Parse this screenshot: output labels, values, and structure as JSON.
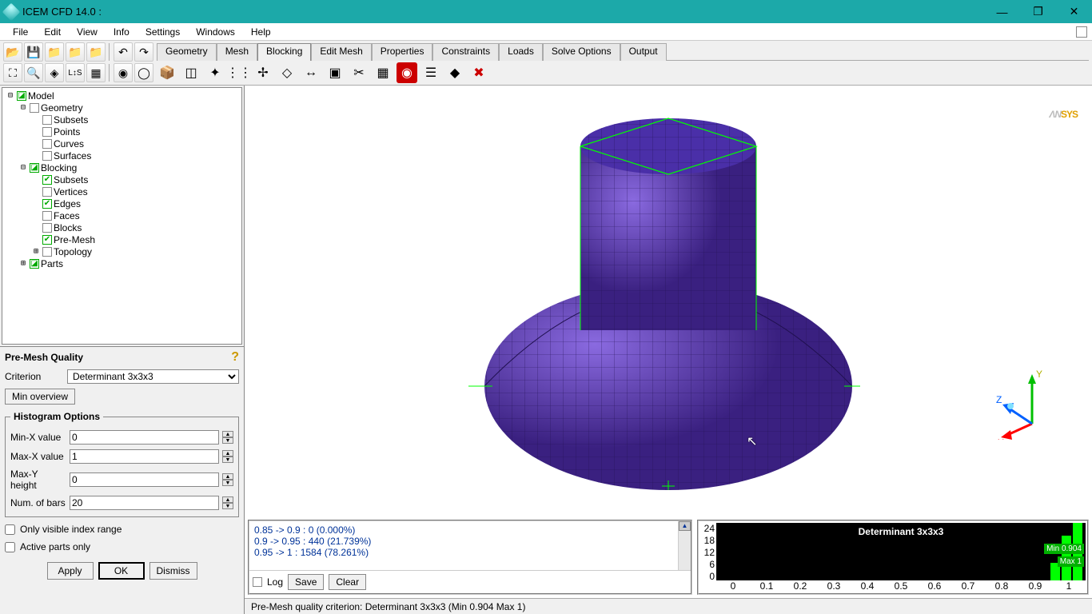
{
  "title": "ICEM CFD 14.0 :",
  "menu": [
    "File",
    "Edit",
    "View",
    "Info",
    "Settings",
    "Windows",
    "Help"
  ],
  "tabs": [
    "Geometry",
    "Mesh",
    "Blocking",
    "Edit Mesh",
    "Properties",
    "Constraints",
    "Loads",
    "Solve Options",
    "Output"
  ],
  "active_tab": 2,
  "tree": [
    {
      "depth": 0,
      "twisty": "⊟",
      "chk": "mixed",
      "label": "Model"
    },
    {
      "depth": 1,
      "twisty": "⊟",
      "chk": "",
      "label": "Geometry"
    },
    {
      "depth": 2,
      "twisty": "",
      "chk": "",
      "label": "Subsets"
    },
    {
      "depth": 2,
      "twisty": "",
      "chk": "",
      "label": "Points"
    },
    {
      "depth": 2,
      "twisty": "",
      "chk": "",
      "label": "Curves"
    },
    {
      "depth": 2,
      "twisty": "",
      "chk": "",
      "label": "Surfaces"
    },
    {
      "depth": 1,
      "twisty": "⊟",
      "chk": "mixed",
      "label": "Blocking"
    },
    {
      "depth": 2,
      "twisty": "",
      "chk": "on",
      "label": "Subsets"
    },
    {
      "depth": 2,
      "twisty": "",
      "chk": "",
      "label": "Vertices"
    },
    {
      "depth": 2,
      "twisty": "",
      "chk": "on",
      "label": "Edges"
    },
    {
      "depth": 2,
      "twisty": "",
      "chk": "",
      "label": "Faces"
    },
    {
      "depth": 2,
      "twisty": "",
      "chk": "",
      "label": "Blocks"
    },
    {
      "depth": 2,
      "twisty": "",
      "chk": "on",
      "label": "Pre-Mesh"
    },
    {
      "depth": 2,
      "twisty": "⊞",
      "chk": "",
      "label": "Topology"
    },
    {
      "depth": 1,
      "twisty": "⊞",
      "chk": "mixed",
      "label": "Parts"
    }
  ],
  "panel": {
    "title": "Pre-Mesh Quality",
    "criterion_label": "Criterion",
    "criterion_value": "Determinant 3x3x3",
    "min_overview": "Min overview",
    "hist_legend": "Histogram Options",
    "minx_label": "Min-X value",
    "minx_value": "0",
    "maxx_label": "Max-X value",
    "maxx_value": "1",
    "maxy_label": "Max-Y height",
    "maxy_value": "0",
    "bars_label": "Num. of bars",
    "bars_value": "20",
    "only_visible": "Only visible index range",
    "active_parts": "Active parts only",
    "apply": "Apply",
    "ok": "OK",
    "dismiss": "Dismiss"
  },
  "log": {
    "lines": [
      "0.85 -> 0.9 : 0 (0.000%)",
      "0.9 -> 0.95 : 440 (21.739%)",
      "0.95 -> 1 : 1584 (78.261%)"
    ],
    "log_label": "Log",
    "save": "Save",
    "clear": "Clear"
  },
  "histogram": {
    "title": "Determinant 3x3x3",
    "yticks": [
      "24",
      "18",
      "12",
      "6",
      "0"
    ],
    "xticks": [
      "0",
      "0.1",
      "0.2",
      "0.3",
      "0.4",
      "0.5",
      "0.6",
      "0.7",
      "0.8",
      "0.9",
      "1"
    ],
    "legend_min": "Min 0.904",
    "legend_max": "Max 1"
  },
  "chart_data": {
    "type": "bar",
    "title": "Determinant 3x3x3",
    "xlabel": "",
    "ylabel": "",
    "xlim": [
      0,
      1
    ],
    "ylim": [
      0,
      24
    ],
    "categories": [
      "0.85-0.9",
      "0.9-0.95",
      "0.95-1"
    ],
    "values": [
      0,
      440,
      1584
    ],
    "percentages": [
      0.0,
      21.739,
      78.261
    ],
    "display_y_scale": "counts not directly on y-axis; bars shown near x=0.9–1 range",
    "min": 0.904,
    "max": 1
  },
  "status": "Pre-Mesh quality criterion: Determinant 3x3x3 (Min 0.904 Max 1)",
  "brand": {
    "part1": "ΛN",
    "part2": "SYS"
  },
  "axes": {
    "x": "X",
    "y": "Y",
    "z": "Z"
  }
}
